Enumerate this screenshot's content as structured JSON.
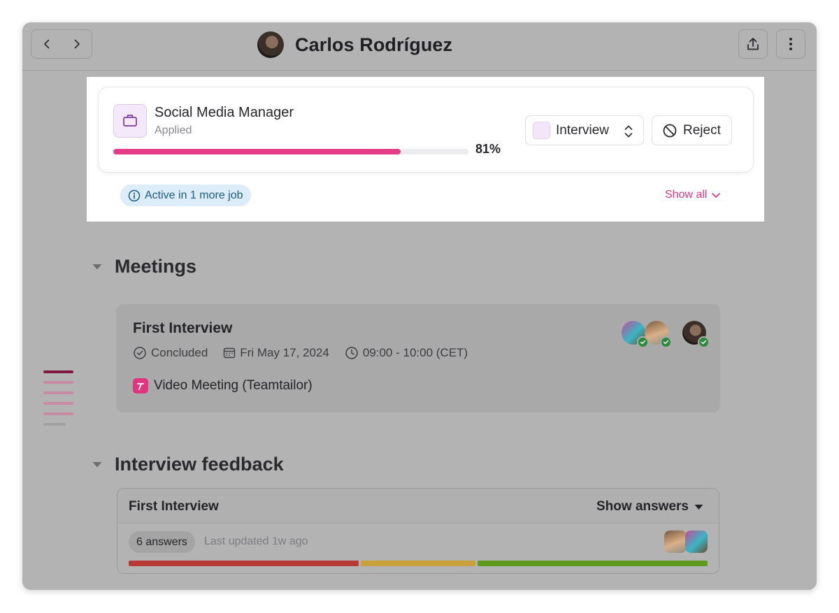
{
  "header": {
    "title": "Carlos Rodríguez",
    "icons": [
      "chevron-left-icon",
      "chevron-right-icon",
      "share-icon",
      "more-vertical-icon"
    ]
  },
  "job": {
    "title": "Social Media Manager",
    "status": "Applied",
    "match_percent_label": "81%",
    "match_fraction": 0.81,
    "stage": "Interview",
    "reject_label": "Reject",
    "active_label": "Active in 1 more job",
    "show_all_label": "Show all",
    "colors": {
      "accent": "#e63b86",
      "info_bg": "#dcecf8",
      "info_text": "#1d5a86"
    }
  },
  "meetings": {
    "section_title": "Meetings",
    "items": [
      {
        "title": "First Interview",
        "status": "Concluded",
        "date": "Fri May 17, 2024",
        "time": "09:00 - 10:00 (CET)",
        "location": "Video Meeting (Teamtailor)"
      }
    ]
  },
  "feedback": {
    "section_title": "Interview feedback",
    "items": [
      {
        "title": "First Interview",
        "toggle_label": "Show answers",
        "answers_label": "6 answers",
        "updated_label": "Last updated 1w ago",
        "score_segments": [
          {
            "share": 2,
            "color": "#b83a36"
          },
          {
            "share": 1,
            "color": "#c8a13a"
          },
          {
            "share": 2,
            "color": "#5e9a1e"
          }
        ]
      }
    ]
  },
  "minimap_colors": [
    "#7f1840",
    "#c98aa3",
    "#c98aa3",
    "#c98aa3",
    "#c98aa3",
    "#a1a1a1"
  ]
}
